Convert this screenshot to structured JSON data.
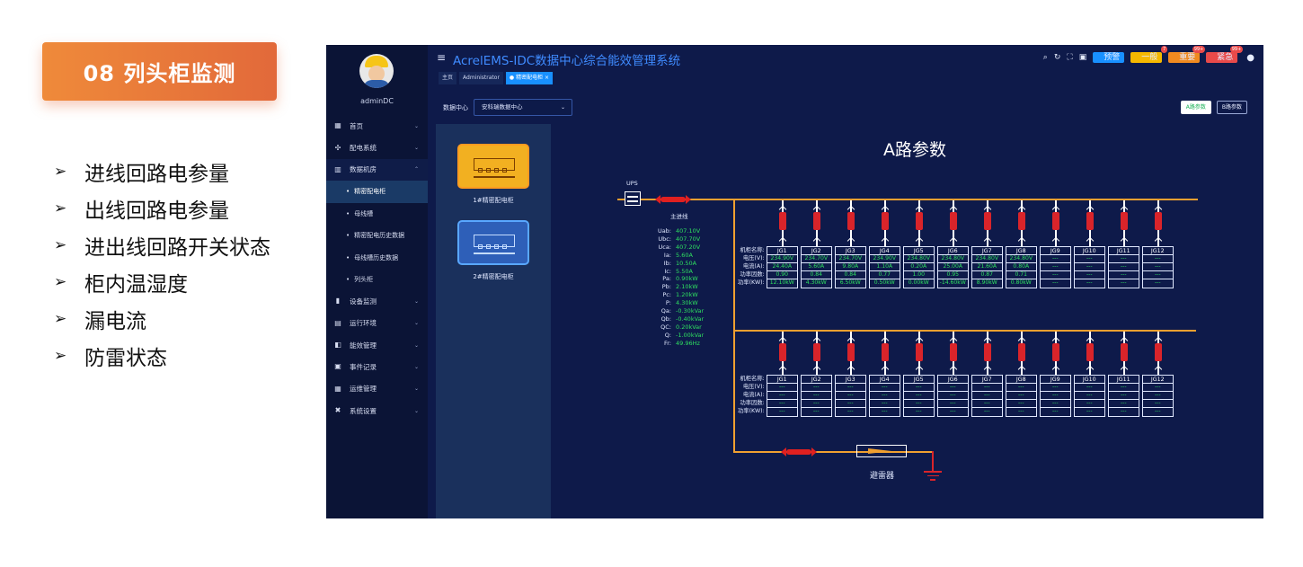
{
  "slide": {
    "badge": "08 列头柜监测",
    "features": [
      "进线回路电参量",
      "出线回路电参量",
      "进出线回路开关状态",
      "柜内温湿度",
      "漏电流",
      "防雷状态"
    ]
  },
  "app": {
    "title": "AcrelEMS-IDC数据中心综合能效管理系统",
    "user": "adminDC",
    "topbar_buttons": [
      {
        "label": "预警",
        "color": "#1890ff",
        "count": ""
      },
      {
        "label": "一般",
        "color": "#f5b800",
        "count": "7"
      },
      {
        "label": "重要",
        "color": "#f08a20",
        "count": "99+"
      },
      {
        "label": "紧急",
        "color": "#e84a4a",
        "count": "99+"
      }
    ],
    "tabs": [
      "主页",
      "Administrator",
      "● 精密配电柜 ×"
    ],
    "menu": [
      {
        "label": "首页",
        "icon": "▦",
        "chev": "⌄",
        "type": "top"
      },
      {
        "label": "配电系统",
        "icon": "✣",
        "chev": "⌄",
        "type": "top"
      },
      {
        "label": "数据机房",
        "icon": "▥",
        "chev": "⌃",
        "type": "open"
      },
      {
        "label": "精密配电柜",
        "type": "sub-active"
      },
      {
        "label": "母线槽",
        "type": "sub"
      },
      {
        "label": "精密配电历史数据",
        "type": "sub"
      },
      {
        "label": "母线槽历史数据",
        "type": "sub"
      },
      {
        "label": "列头柜",
        "type": "sub"
      },
      {
        "label": "设备监测",
        "icon": "▮",
        "chev": "⌄",
        "type": "top"
      },
      {
        "label": "运行环境",
        "icon": "▤",
        "chev": "⌄",
        "type": "top"
      },
      {
        "label": "能效管理",
        "icon": "◧",
        "chev": "⌄",
        "type": "top"
      },
      {
        "label": "事件记录",
        "icon": "▣",
        "chev": "⌄",
        "type": "top"
      },
      {
        "label": "运维管理",
        "icon": "▦",
        "chev": "⌄",
        "type": "top"
      },
      {
        "label": "系统设置",
        "icon": "✖",
        "chev": "⌄",
        "type": "top"
      }
    ],
    "filter": {
      "label": "数据中心",
      "value": "安科瑞数据中心"
    },
    "param_buttons": [
      "A路参数",
      "B路参数"
    ],
    "cabinets": [
      "1#精密配电柜",
      "2#精密配电柜"
    ],
    "panel_title": "A路参数",
    "ups_label": "UPS",
    "main_label": "主进线",
    "main_measurements": [
      {
        "k": "Uab:",
        "v": "407.10V"
      },
      {
        "k": "Ubc:",
        "v": "407.70V"
      },
      {
        "k": "Uca:",
        "v": "407.20V"
      },
      {
        "k": "Ia:",
        "v": "5.60A"
      },
      {
        "k": "Ib:",
        "v": "10.50A"
      },
      {
        "k": "Ic:",
        "v": "5.50A"
      },
      {
        "k": "Pa:",
        "v": "0.90kW"
      },
      {
        "k": "Pb:",
        "v": "2.10kW"
      },
      {
        "k": "Pc:",
        "v": "1.20kW"
      },
      {
        "k": "P:",
        "v": "4.30kW"
      },
      {
        "k": "Qa:",
        "v": "-0.30kVar"
      },
      {
        "k": "Qb:",
        "v": "-0.40kVar"
      },
      {
        "k": "QC:",
        "v": "0.20kVar"
      },
      {
        "k": "Q:",
        "v": "-1.00kVar"
      },
      {
        "k": "Fr:",
        "v": "49.96Hz"
      }
    ],
    "row_labels": [
      "机柜名称:",
      "电压(V):",
      "电流(A):",
      "功率因数:",
      "功率(KW):"
    ],
    "feeders_top": [
      {
        "name": "JG1",
        "v": "234.90V",
        "a": "24.40A",
        "pf": "0.90",
        "kw": "12.10kW"
      },
      {
        "name": "JG2",
        "v": "234.70V",
        "a": "5.60A",
        "pf": "0.84",
        "kw": "4.30kW"
      },
      {
        "name": "JG3",
        "v": "234.70V",
        "a": "9.80A",
        "pf": "0.84",
        "kw": "6.50kW"
      },
      {
        "name": "JG4",
        "v": "234.90V",
        "a": "1.10A",
        "pf": "0.77",
        "kw": "0.50kW"
      },
      {
        "name": "JG5",
        "v": "234.80V",
        "a": "0.20A",
        "pf": "1.00",
        "kw": "0.00kW"
      },
      {
        "name": "JG6",
        "v": "234.80V",
        "a": "25.00A",
        "pf": "0.95",
        "kw": "-14.60kW"
      },
      {
        "name": "JG7",
        "v": "234.80V",
        "a": "21.60A",
        "pf": "0.87",
        "kw": "8.90kW"
      },
      {
        "name": "JG8",
        "v": "234.80V",
        "a": "0.80A",
        "pf": "0.71",
        "kw": "0.80kW"
      },
      {
        "name": "JG9",
        "v": "---",
        "a": "---",
        "pf": "---",
        "kw": "---"
      },
      {
        "name": "JG10",
        "v": "---",
        "a": "---",
        "pf": "---",
        "kw": "---"
      },
      {
        "name": "JG11",
        "v": "---",
        "a": "---",
        "pf": "---",
        "kw": "---"
      },
      {
        "name": "JG12",
        "v": "---",
        "a": "---",
        "pf": "---",
        "kw": "---"
      }
    ],
    "feeders_bottom": [
      {
        "name": "JG1",
        "v": "---",
        "a": "---",
        "pf": "---",
        "kw": "---"
      },
      {
        "name": "JG2",
        "v": "---",
        "a": "---",
        "pf": "---",
        "kw": "---"
      },
      {
        "name": "JG3",
        "v": "---",
        "a": "---",
        "pf": "---",
        "kw": "---"
      },
      {
        "name": "JG4",
        "v": "---",
        "a": "---",
        "pf": "---",
        "kw": "---"
      },
      {
        "name": "JG5",
        "v": "---",
        "a": "---",
        "pf": "---",
        "kw": "---"
      },
      {
        "name": "JG6",
        "v": "---",
        "a": "---",
        "pf": "---",
        "kw": "---"
      },
      {
        "name": "JG7",
        "v": "---",
        "a": "---",
        "pf": "---",
        "kw": "---"
      },
      {
        "name": "JG8",
        "v": "---",
        "a": "---",
        "pf": "---",
        "kw": "---"
      },
      {
        "name": "JG9",
        "v": "---",
        "a": "---",
        "pf": "---",
        "kw": "---"
      },
      {
        "name": "JG10",
        "v": "---",
        "a": "---",
        "pf": "---",
        "kw": "---"
      },
      {
        "name": "JG11",
        "v": "---",
        "a": "---",
        "pf": "---",
        "kw": "---"
      },
      {
        "name": "JG12",
        "v": "---",
        "a": "---",
        "pf": "---",
        "kw": "---"
      }
    ],
    "surge_label": "避雷器",
    "colors": {
      "accent": "#3f8bff",
      "bus": "#f0a030",
      "value": "#2fe060",
      "breaker": "#d9242a"
    }
  }
}
